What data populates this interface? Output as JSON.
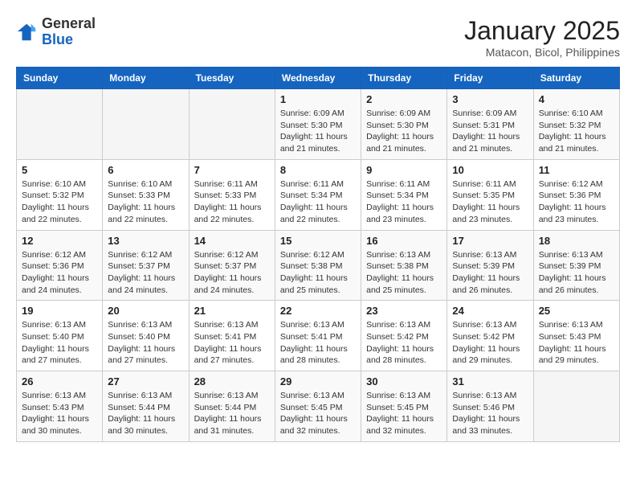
{
  "logo": {
    "line1": "General",
    "line2": "Blue"
  },
  "title": "January 2025",
  "subtitle": "Matacon, Bicol, Philippines",
  "days_of_week": [
    "Sunday",
    "Monday",
    "Tuesday",
    "Wednesday",
    "Thursday",
    "Friday",
    "Saturday"
  ],
  "weeks": [
    [
      {
        "day": "",
        "info": ""
      },
      {
        "day": "",
        "info": ""
      },
      {
        "day": "",
        "info": ""
      },
      {
        "day": "1",
        "info": "Sunrise: 6:09 AM\nSunset: 5:30 PM\nDaylight: 11 hours\nand 21 minutes."
      },
      {
        "day": "2",
        "info": "Sunrise: 6:09 AM\nSunset: 5:30 PM\nDaylight: 11 hours\nand 21 minutes."
      },
      {
        "day": "3",
        "info": "Sunrise: 6:09 AM\nSunset: 5:31 PM\nDaylight: 11 hours\nand 21 minutes."
      },
      {
        "day": "4",
        "info": "Sunrise: 6:10 AM\nSunset: 5:32 PM\nDaylight: 11 hours\nand 21 minutes."
      }
    ],
    [
      {
        "day": "5",
        "info": "Sunrise: 6:10 AM\nSunset: 5:32 PM\nDaylight: 11 hours\nand 22 minutes."
      },
      {
        "day": "6",
        "info": "Sunrise: 6:10 AM\nSunset: 5:33 PM\nDaylight: 11 hours\nand 22 minutes."
      },
      {
        "day": "7",
        "info": "Sunrise: 6:11 AM\nSunset: 5:33 PM\nDaylight: 11 hours\nand 22 minutes."
      },
      {
        "day": "8",
        "info": "Sunrise: 6:11 AM\nSunset: 5:34 PM\nDaylight: 11 hours\nand 22 minutes."
      },
      {
        "day": "9",
        "info": "Sunrise: 6:11 AM\nSunset: 5:34 PM\nDaylight: 11 hours\nand 23 minutes."
      },
      {
        "day": "10",
        "info": "Sunrise: 6:11 AM\nSunset: 5:35 PM\nDaylight: 11 hours\nand 23 minutes."
      },
      {
        "day": "11",
        "info": "Sunrise: 6:12 AM\nSunset: 5:36 PM\nDaylight: 11 hours\nand 23 minutes."
      }
    ],
    [
      {
        "day": "12",
        "info": "Sunrise: 6:12 AM\nSunset: 5:36 PM\nDaylight: 11 hours\nand 24 minutes."
      },
      {
        "day": "13",
        "info": "Sunrise: 6:12 AM\nSunset: 5:37 PM\nDaylight: 11 hours\nand 24 minutes."
      },
      {
        "day": "14",
        "info": "Sunrise: 6:12 AM\nSunset: 5:37 PM\nDaylight: 11 hours\nand 24 minutes."
      },
      {
        "day": "15",
        "info": "Sunrise: 6:12 AM\nSunset: 5:38 PM\nDaylight: 11 hours\nand 25 minutes."
      },
      {
        "day": "16",
        "info": "Sunrise: 6:13 AM\nSunset: 5:38 PM\nDaylight: 11 hours\nand 25 minutes."
      },
      {
        "day": "17",
        "info": "Sunrise: 6:13 AM\nSunset: 5:39 PM\nDaylight: 11 hours\nand 26 minutes."
      },
      {
        "day": "18",
        "info": "Sunrise: 6:13 AM\nSunset: 5:39 PM\nDaylight: 11 hours\nand 26 minutes."
      }
    ],
    [
      {
        "day": "19",
        "info": "Sunrise: 6:13 AM\nSunset: 5:40 PM\nDaylight: 11 hours\nand 27 minutes."
      },
      {
        "day": "20",
        "info": "Sunrise: 6:13 AM\nSunset: 5:40 PM\nDaylight: 11 hours\nand 27 minutes."
      },
      {
        "day": "21",
        "info": "Sunrise: 6:13 AM\nSunset: 5:41 PM\nDaylight: 11 hours\nand 27 minutes."
      },
      {
        "day": "22",
        "info": "Sunrise: 6:13 AM\nSunset: 5:41 PM\nDaylight: 11 hours\nand 28 minutes."
      },
      {
        "day": "23",
        "info": "Sunrise: 6:13 AM\nSunset: 5:42 PM\nDaylight: 11 hours\nand 28 minutes."
      },
      {
        "day": "24",
        "info": "Sunrise: 6:13 AM\nSunset: 5:42 PM\nDaylight: 11 hours\nand 29 minutes."
      },
      {
        "day": "25",
        "info": "Sunrise: 6:13 AM\nSunset: 5:43 PM\nDaylight: 11 hours\nand 29 minutes."
      }
    ],
    [
      {
        "day": "26",
        "info": "Sunrise: 6:13 AM\nSunset: 5:43 PM\nDaylight: 11 hours\nand 30 minutes."
      },
      {
        "day": "27",
        "info": "Sunrise: 6:13 AM\nSunset: 5:44 PM\nDaylight: 11 hours\nand 30 minutes."
      },
      {
        "day": "28",
        "info": "Sunrise: 6:13 AM\nSunset: 5:44 PM\nDaylight: 11 hours\nand 31 minutes."
      },
      {
        "day": "29",
        "info": "Sunrise: 6:13 AM\nSunset: 5:45 PM\nDaylight: 11 hours\nand 32 minutes."
      },
      {
        "day": "30",
        "info": "Sunrise: 6:13 AM\nSunset: 5:45 PM\nDaylight: 11 hours\nand 32 minutes."
      },
      {
        "day": "31",
        "info": "Sunrise: 6:13 AM\nSunset: 5:46 PM\nDaylight: 11 hours\nand 33 minutes."
      },
      {
        "day": "",
        "info": ""
      }
    ]
  ]
}
